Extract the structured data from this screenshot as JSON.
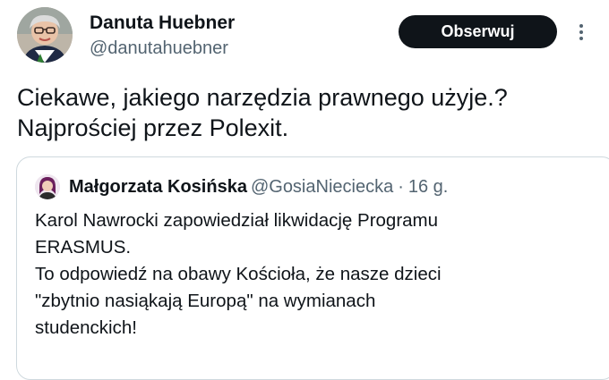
{
  "tweet": {
    "author": {
      "name": "Danuta Huebner",
      "handle": "@danutahuebner"
    },
    "follow_label": "Obserwuj",
    "text_lines": [
      "Ciekawe, jakiego narzędzia prawnego użyje.?",
      "Najprościej przez Polexit."
    ]
  },
  "quoted": {
    "author": {
      "name": "Małgorzata Kosińska",
      "handle": "@GosiaNieciecka"
    },
    "separator": "·",
    "time": "16 g.",
    "text_lines": [
      "Karol Nawrocki zapowiedział likwidację Programu",
      "ERASMUS.",
      "To odpowiedź na obawy Kościoła, że nasze dzieci",
      "\"zbytnio nasiąkają Europą\" na wymianach",
      "studenckich!"
    ]
  },
  "icons": {
    "more": "more-icon",
    "avatar": "avatar",
    "quote_avatar": "quote-avatar"
  },
  "colors": {
    "text": "#0f1419",
    "secondary": "#536471",
    "button_bg": "#0f1419",
    "border": "#cfd9de"
  }
}
